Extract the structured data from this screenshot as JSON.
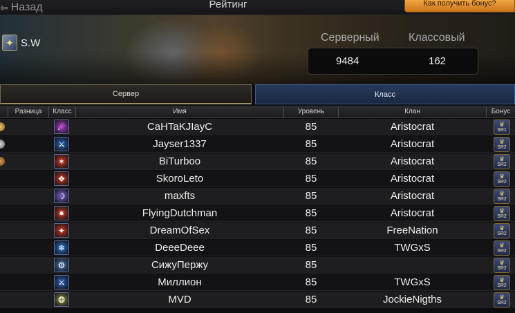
{
  "header": {
    "back_label": "Назад",
    "title": "Рейтинг",
    "help_button": "Как получить бонус?"
  },
  "user": {
    "name": "S.W"
  },
  "stats": {
    "server_label": "Серверный",
    "class_label": "Классовый",
    "server_value": "9484",
    "class_value": "162"
  },
  "tabs": {
    "server": "Сервер",
    "class": "Класс",
    "active": "class"
  },
  "table": {
    "columns": [
      "Разница",
      "Класс",
      "Имя",
      "Уровень",
      "Клан",
      "Бонус"
    ],
    "rows": [
      {
        "name": "CaHTaKJIayC",
        "level": "85",
        "clan": "Aristocrat",
        "bonus": "SR1",
        "cls_color": "#b040c8"
      },
      {
        "name": "Jayser1337",
        "level": "85",
        "clan": "Aristocrat",
        "bonus": "SR2",
        "cls_color": "#2a62b8"
      },
      {
        "name": "BiTurboo",
        "level": "85",
        "clan": "Aristocrat",
        "bonus": "SR2",
        "cls_color": "#c8381e"
      },
      {
        "name": "SkoroLeto",
        "level": "85",
        "clan": "Aristocrat",
        "bonus": "SR2",
        "cls_color": "#c8381e"
      },
      {
        "name": "maxfts",
        "level": "85",
        "clan": "Aristocrat",
        "bonus": "SR2",
        "cls_color": "#7a62c8"
      },
      {
        "name": "FlyingDutchman",
        "level": "85",
        "clan": "Aristocrat",
        "bonus": "SR2",
        "cls_color": "#c8381e"
      },
      {
        "name": "DreamOfSex",
        "level": "85",
        "clan": "FreeNation",
        "bonus": "SR2",
        "cls_color": "#c8381e"
      },
      {
        "name": "DeeeDeee",
        "level": "85",
        "clan": "TWGxS",
        "bonus": "SR2",
        "cls_color": "#2a72c8"
      },
      {
        "name": "СижуПержу",
        "level": "85",
        "clan": "",
        "bonus": "SR2",
        "cls_color": "#4a7aa8"
      },
      {
        "name": "Миллион",
        "level": "85",
        "clan": "TWGxS",
        "bonus": "SR2",
        "cls_color": "#2a62b8"
      },
      {
        "name": "MVD",
        "level": "85",
        "clan": "JockieNigths",
        "bonus": "SR2",
        "cls_color": "#8a8a3a"
      }
    ]
  }
}
